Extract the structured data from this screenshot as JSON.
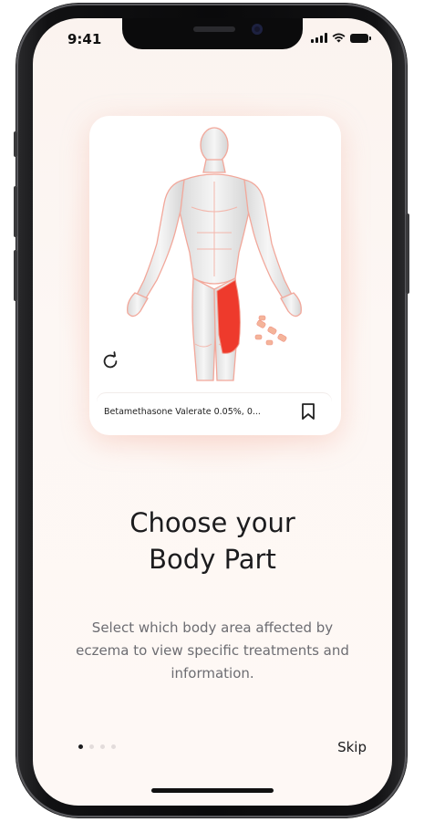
{
  "status_bar": {
    "time": "9:41"
  },
  "card": {
    "medication_name": "Betamethasone Valerate 0.05%, 0...",
    "highlight_color": "#ee3a2c"
  },
  "onboarding": {
    "title_line1": "Choose your",
    "title_line2": "Body Part",
    "description": "Select which body area affected by eczema to view specific treatments and information.",
    "skip_label": "Skip",
    "page_count": 4,
    "current_page": 1
  },
  "icons": {
    "reload": "reload-icon",
    "bookmark": "bookmark-icon",
    "signal": "cellular-signal-icon",
    "wifi": "wifi-icon",
    "battery": "battery-icon"
  }
}
